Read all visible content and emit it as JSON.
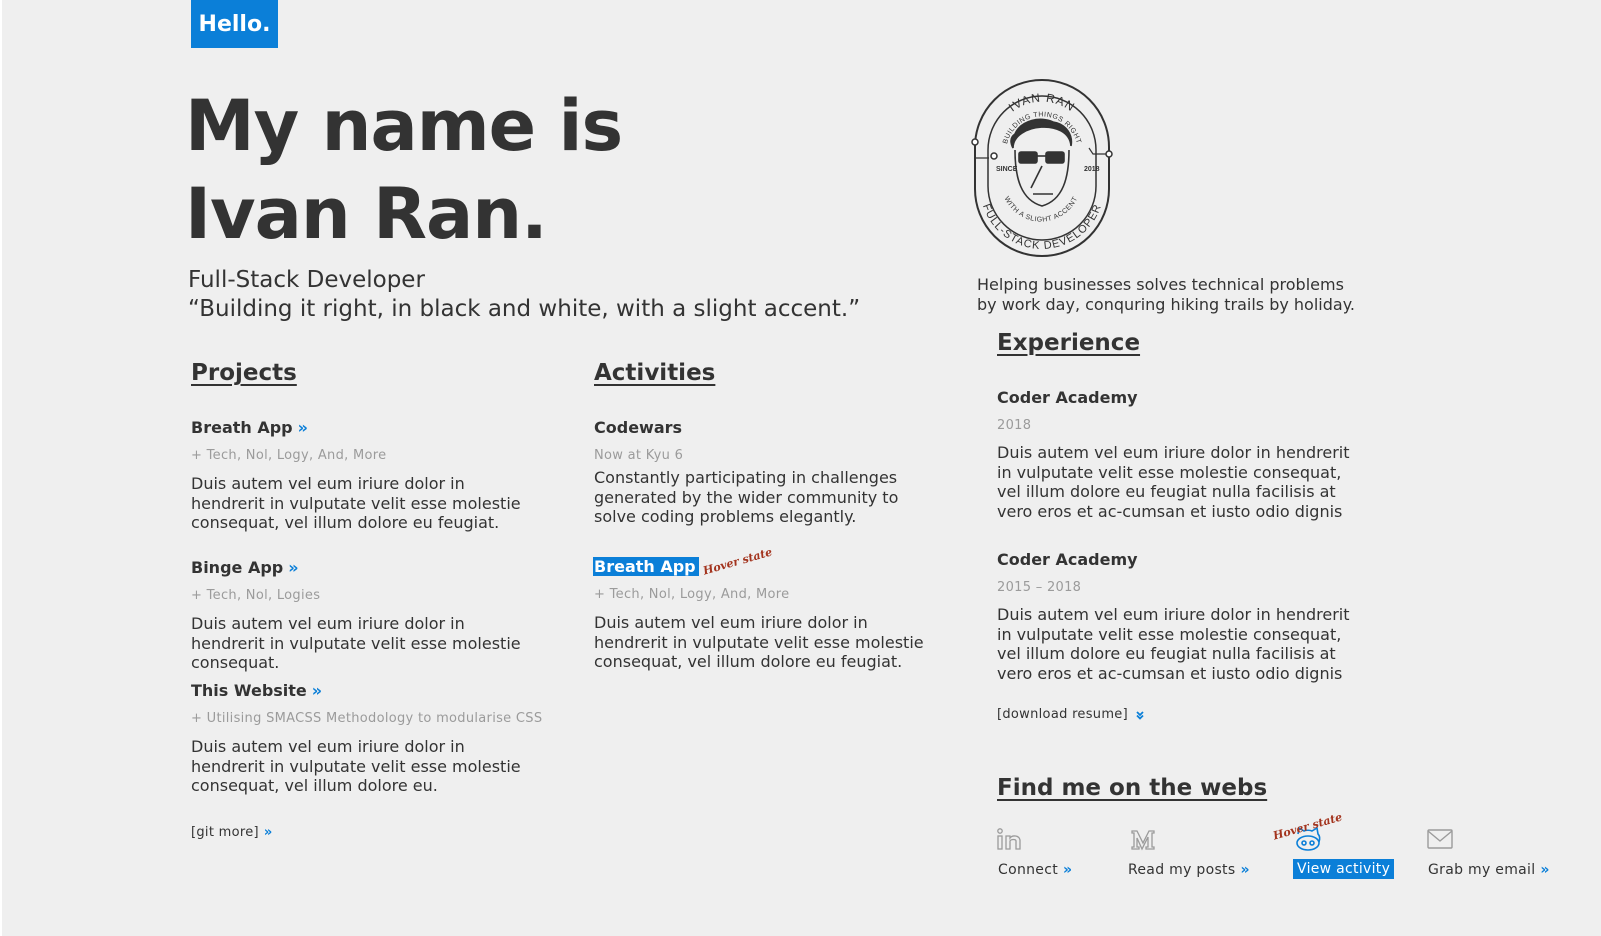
{
  "hello_badge": "Hello.",
  "hero": {
    "name_line1": "My name is",
    "name_line2": "Ivan Ran.",
    "role": "Full-Stack Developer",
    "tagline": "“Building it right, in black and white, with a slight accent.”"
  },
  "logo_badge": {
    "top_text": "IVAN RAN",
    "arc_text": "BUILDING THINGS RIGHT",
    "since_label": "SINCE",
    "year": "2018",
    "accent_text": "WITH A SLIGHT ACCENT",
    "bottom_text": "FULL-STACK DEVELOPER"
  },
  "about": "Helping businesses solves technical problems by work day, conquring hiking trails by holiday.",
  "projects": {
    "heading": "Projects",
    "items": [
      {
        "title": "Breath App",
        "link": "»",
        "meta": "+ Tech, Nol, Logy, And, More",
        "desc": "Duis autem vel eum iriure dolor in hendrerit in vulputate velit esse molestie consequat, vel illum dolore eu feugiat."
      },
      {
        "title": "Binge App",
        "link": "»",
        "meta": "+ Tech, Nol, Logies",
        "desc": "Duis autem vel eum iriure dolor in hendrerit in vulputate velit esse molestie consequat."
      },
      {
        "title": "This Website",
        "link": "»",
        "meta": "+ Utilising SMACSS Methodology to modularise CSS",
        "desc": "Duis autem vel eum iriure dolor in hendrerit in vulputate velit esse molestie consequat, vel illum dolore eu."
      }
    ],
    "more_link": "[git more]",
    "more_arrow": "»"
  },
  "activities": {
    "heading": "Activities",
    "items": [
      {
        "title": "Codewars",
        "meta": "Now at Kyu 6",
        "desc": "Constantly participating in challenges generated by the wider community to solve coding problems elegantly."
      },
      {
        "title": "Breath App",
        "meta": "+ Tech, Nol, Logy, And, More",
        "desc": "Duis autem vel eum iriure dolor in hendrerit in vulputate velit esse molestie consequat, vel illum dolore eu feugiat.",
        "hover_note": "Hover state"
      }
    ]
  },
  "experience": {
    "heading": "Experience",
    "items": [
      {
        "title": "Coder Academy",
        "date": "2018",
        "desc": "Duis autem vel eum iriure dolor in hendrerit in vulputate velit esse molestie consequat, vel illum dolore eu feugiat nulla facilisis at vero eros et ac-cumsan et iusto odio dignis"
      },
      {
        "title": "Coder Academy",
        "date": "2015 – 2018",
        "desc": "Duis autem vel eum iriure dolor in hendrerit in vulputate velit esse molestie consequat, vel illum dolore eu feugiat nulla facilisis at vero eros et ac-cumsan et iusto odio dignis"
      }
    ],
    "download_link": "[download resume]"
  },
  "webs": {
    "heading": "Find me on the webs",
    "links": [
      {
        "icon": "linkedin-icon",
        "label": "Connect",
        "arrow": "»"
      },
      {
        "icon": "medium-icon",
        "label": "Read my posts",
        "arrow": "»"
      },
      {
        "icon": "github-icon",
        "label": "View activity",
        "hover_note": "Hover state"
      },
      {
        "icon": "email-icon",
        "label": "Grab my email",
        "arrow": "»"
      }
    ]
  },
  "colors": {
    "accent": "#0b7fd8",
    "background": "#efefef",
    "text": "#333333",
    "muted": "#9b9b9b",
    "hover_note": "#a3341e"
  }
}
